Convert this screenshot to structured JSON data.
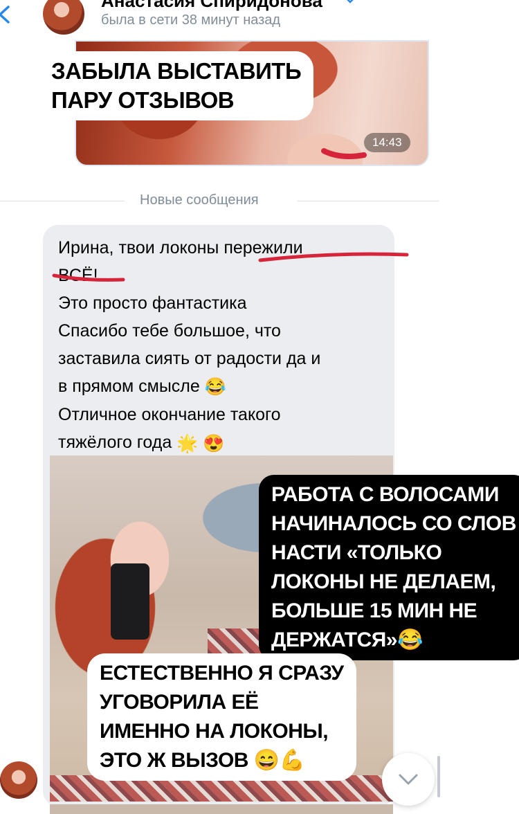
{
  "header": {
    "contact_name": "Анастасия Спиридонова",
    "last_seen": "была в сети 38 минут назад"
  },
  "photo_message": {
    "time": "14:43",
    "overlay_lines": [
      "ЗАБЫЛА ВЫСТАВИТЬ",
      "ПАРУ ОТЗЫВОВ"
    ]
  },
  "divider": {
    "label": "Новые сообщения"
  },
  "incoming_message": {
    "lines": [
      "Ирина, твои локоны пережили",
      "ВСЁ!",
      "Это просто фантастика",
      "Спасибо тебе большое, что",
      "заставила сиять от радости да и",
      "в прямом смысле",
      "Отличное окончание такого",
      "тяжёлого года"
    ],
    "emojis": {
      "line6": "😂",
      "line8": [
        "🌟",
        "😍"
      ]
    }
  },
  "story_overlays": {
    "black_box": [
      "РАБОТА С ВОЛОСАМИ",
      "НАЧИНАЛОСЬ СО СЛОВ",
      "НАСТИ «ТОЛЬКО",
      "ЛОКОНЫ НЕ ДЕЛАЕМ,",
      "БОЛЬШЕ 15 МИН НЕ",
      "ДЕРЖАТСЯ»"
    ],
    "black_box_emoji": "😂",
    "white_box": [
      "ЕСТЕСТВЕННО Я СРАЗУ",
      "УГОВОРИЛА ЕЁ",
      "ИМЕННО НА ЛОКОНЫ,",
      "ЭТО Ж ВЫЗОВ"
    ],
    "white_box_emoji": "😄💪"
  },
  "icons": [
    "chevron-left-icon",
    "chevron-down-icon",
    "avatar"
  ],
  "colors": {
    "accent": "#2688eb",
    "annotation_red": "#d6253a",
    "bubble_bg": "#ebedf0",
    "secondary_text": "#818c99"
  }
}
